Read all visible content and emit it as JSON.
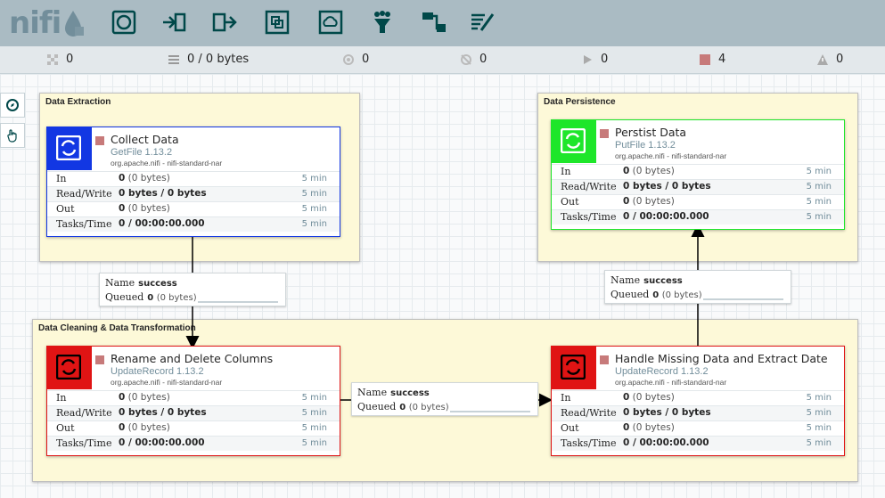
{
  "app": {
    "logo_text": "nifi"
  },
  "toolbar": {
    "buttons": [
      {
        "name": "processor",
        "icon": "processor-icon"
      },
      {
        "name": "input-port",
        "icon": "input-port-icon"
      },
      {
        "name": "output-port",
        "icon": "output-port-icon"
      },
      {
        "name": "process-group",
        "icon": "process-group-icon"
      },
      {
        "name": "remote-process-group",
        "icon": "remote-process-group-icon"
      },
      {
        "name": "funnel",
        "icon": "funnel-icon"
      },
      {
        "name": "template",
        "icon": "template-icon"
      },
      {
        "name": "label",
        "icon": "label-icon"
      }
    ]
  },
  "status": {
    "active_threads": "0",
    "queued": "0 / 0 bytes",
    "transmitting": "0",
    "not_transmitting": "0",
    "running": "0",
    "stopped": "4",
    "invalid": "0"
  },
  "groups": {
    "extraction": "Data Extraction",
    "persistence": "Data Persistence",
    "cleaning": "Data Cleaning & Data Transformation"
  },
  "row_labels": {
    "in": "In",
    "rw": "Read/Write",
    "out": "Out",
    "tasks": "Tasks/Time"
  },
  "processors": {
    "collect": {
      "name": "Collect Data",
      "type": "GetFile 1.13.2",
      "bundle": "org.apache.nifi - nifi-standard-nar",
      "in_count": "0",
      "in_bytes": "(0 bytes)",
      "rw": "0 bytes / 0 bytes",
      "out_count": "0",
      "out_bytes": "(0 bytes)",
      "tasks": "0 / 00:00:00.000",
      "window": "5 min",
      "color": "#1237e3"
    },
    "persist": {
      "name": "Perstist Data",
      "type": "PutFile 1.13.2",
      "bundle": "org.apache.nifi - nifi-standard-nar",
      "in_count": "0",
      "in_bytes": "(0 bytes)",
      "rw": "0 bytes / 0 bytes",
      "out_count": "0",
      "out_bytes": "(0 bytes)",
      "tasks": "0 / 00:00:00.000",
      "window": "5 min",
      "color": "#1ee62a"
    },
    "rename": {
      "name": "Rename and Delete Columns",
      "type": "UpdateRecord 1.13.2",
      "bundle": "org.apache.nifi - nifi-standard-nar",
      "in_count": "0",
      "in_bytes": "(0 bytes)",
      "rw": "0 bytes / 0 bytes",
      "out_count": "0",
      "out_bytes": "(0 bytes)",
      "tasks": "0 / 00:00:00.000",
      "window": "5 min",
      "color": "#e01414"
    },
    "handle": {
      "name": "Handle Missing Data and Extract Date",
      "type": "UpdateRecord 1.13.2",
      "bundle": "org.apache.nifi - nifi-standard-nar",
      "in_count": "0",
      "in_bytes": "(0 bytes)",
      "rw": "0 bytes / 0 bytes",
      "out_count": "0",
      "out_bytes": "(0 bytes)",
      "tasks": "0 / 00:00:00.000",
      "window": "5 min",
      "color": "#e01414"
    }
  },
  "connections": {
    "name_label": "Name",
    "queued_label": "Queued",
    "c1": {
      "name": "success",
      "count": "0",
      "bytes": "(0 bytes)"
    },
    "c2": {
      "name": "success",
      "count": "0",
      "bytes": "(0 bytes)"
    },
    "c3": {
      "name": "success",
      "count": "0",
      "bytes": "(0 bytes)"
    }
  }
}
